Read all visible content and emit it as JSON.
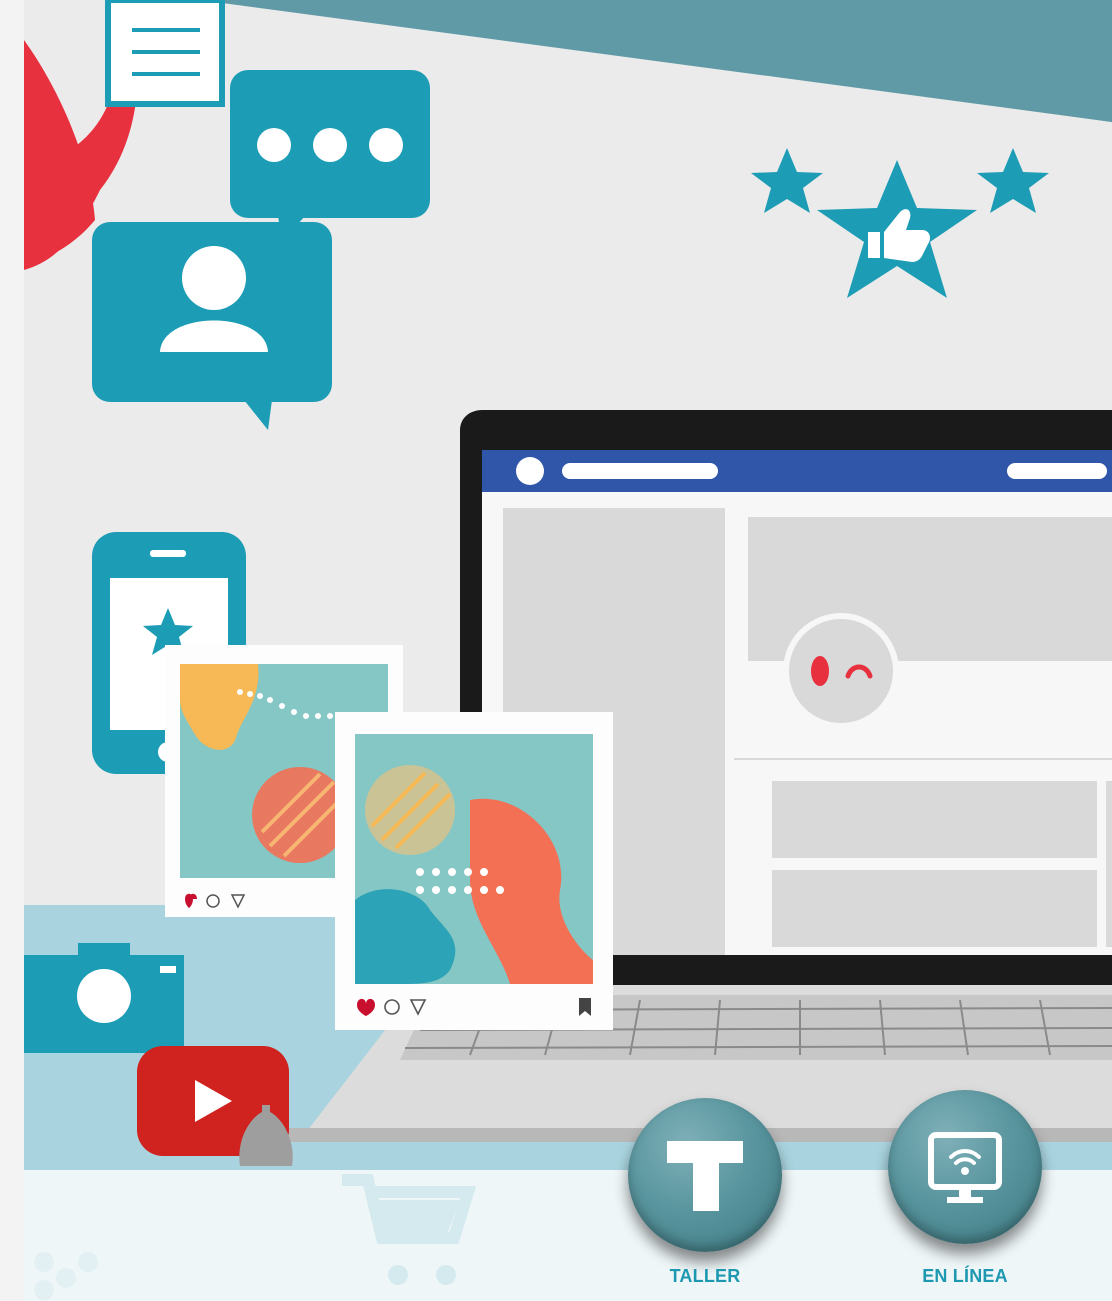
{
  "badges": [
    {
      "id": "taller",
      "label": "TALLER",
      "icon": "letter-t-icon",
      "glyph": "T"
    },
    {
      "id": "en_linea",
      "label": "EN LÍNEA",
      "icon": "wifi-monitor-icon"
    }
  ],
  "colors": {
    "teal": "#1d9cb5",
    "teal_dark": "#5a969f",
    "red": "#e8313f",
    "facebook_blue": "#2f56a8",
    "background": "#ebebeb",
    "label": "#1d98b0"
  },
  "icons": [
    "document-icon",
    "chat-bubble-icon",
    "user-chat-icon",
    "star-icon",
    "thumbs-up-icon",
    "smartphone-icon",
    "camera-icon",
    "video-play-icon",
    "shopping-cart-icon",
    "laptop-illustration",
    "social-post-card",
    "heart-icon",
    "comment-icon",
    "send-icon",
    "bookmark-icon"
  ]
}
